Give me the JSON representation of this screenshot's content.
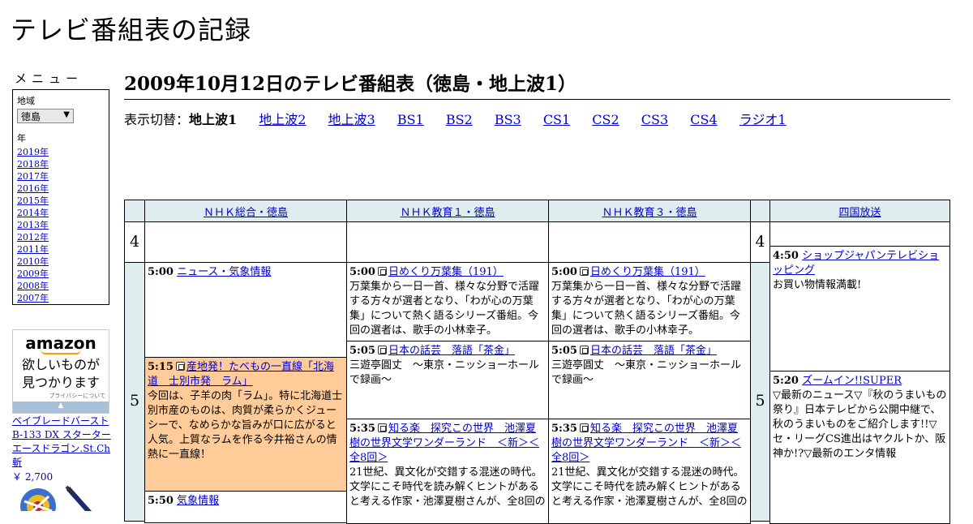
{
  "site_title": "テレビ番組表の記録",
  "menu": {
    "label": "メニュー",
    "region_label": "地域",
    "region_value": "徳島",
    "year_label": "年",
    "years": [
      "2019年",
      "2018年",
      "2017年",
      "2016年",
      "2015年",
      "2014年",
      "2013年",
      "2012年",
      "2011年",
      "2010年",
      "2009年",
      "2008年",
      "2007年"
    ]
  },
  "ad": {
    "logo": "amazon",
    "tagline_1": "欲しいものが",
    "tagline_2": "見つかります",
    "privacy": "プライバシーについて",
    "product_name": "ベイブレードバースト B-133 DX スターター エースドラゴン.St.Ch 斬",
    "price": "￥ 2,700"
  },
  "heading": "2009年10月12日のテレビ番組表（徳島・地上波1）",
  "switcher": {
    "label": "表示切替：",
    "current": "地上波1",
    "links": [
      "地上波2",
      "地上波3",
      "BS1",
      "BS2",
      "BS3",
      "CS1",
      "CS2",
      "CS3",
      "CS4",
      "ラジオ1"
    ]
  },
  "channels": [
    "ＮＨＫ総合・徳島",
    "ＮＨＫ教育１・徳島",
    "ＮＨＫ教育３・徳島",
    "四国放送"
  ],
  "hours": [
    "4",
    "5"
  ],
  "programs": {
    "nhk_g": [
      {
        "time": "5:00",
        "title": "ニュース・気象情報",
        "desc": ""
      },
      {
        "time": "5:15",
        "title": "産地発！たべもの一直線「北海道　士別市発　ラム」",
        "desc": "今回は、子羊の肉「ラム」。特に北海道士別市産のものは、肉質が柔らかくジューシーで、なめらかな旨みが口に広がると人気。上質なラムを作る今井裕さんの情熱に一直線！"
      },
      {
        "time": "5:50",
        "title": "気象情報",
        "desc": ""
      }
    ],
    "nhk_e1": [
      {
        "time": "5:00",
        "title": "日めくり万葉集（191）",
        "desc": "万葉集から一日一首、様々な分野で活躍する方々が選者となり、「わが心の万葉集」について熱く語るシリーズ番組。今回の選者は、歌手の小林幸子。"
      },
      {
        "time": "5:05",
        "title": "日本の話芸　落語「茶金」",
        "desc": "三遊亭圓丈　～東京・ニッショーホールで録画～"
      },
      {
        "time": "5:35",
        "title": "知る楽　探究この世界　池澤夏樹の世界文学ワンダーランド　＜新＞＜全8回＞",
        "desc": "21世紀、異文化が交錯する混迷の時代。文学にこそ時代を読み解くヒントがあると考える作家・池澤夏樹さんが、全8回の"
      }
    ],
    "nhk_e3": [
      {
        "time": "5:00",
        "title": "日めくり万葉集（191）",
        "desc": "万葉集から一日一首、様々な分野で活躍する方々が選者となり、「わが心の万葉集」について熱く語るシリーズ番組。今回の選者は、歌手の小林幸子。"
      },
      {
        "time": "5:05",
        "title": "日本の話芸　落語「茶金」",
        "desc": "三遊亭圓丈　～東京・ニッショーホールで録画～"
      },
      {
        "time": "5:35",
        "title": "知る楽　探究この世界　池澤夏樹の世界文学ワンダーランド　＜新＞＜全8回＞",
        "desc": "21世紀、異文化が交錯する混迷の時代。文学にこそ時代を読み解くヒントがあると考える作家・池澤夏樹さんが、全8回の"
      }
    ],
    "jrt": [
      {
        "time": "4:50",
        "title": "ショップジャパンテレビショッピング",
        "desc": "お買い物情報満載!"
      },
      {
        "time": "5:20",
        "title": "ズームイン!!SUPER",
        "desc": "▽最新のニュース▽『秋のうまいもの祭り』日本テレビから公開中継で、秋のうまいものをご紹介します!!▽セ・リーグCS進出はヤクルトか、阪神か!?▽最新のエンタ情報"
      }
    ]
  }
}
